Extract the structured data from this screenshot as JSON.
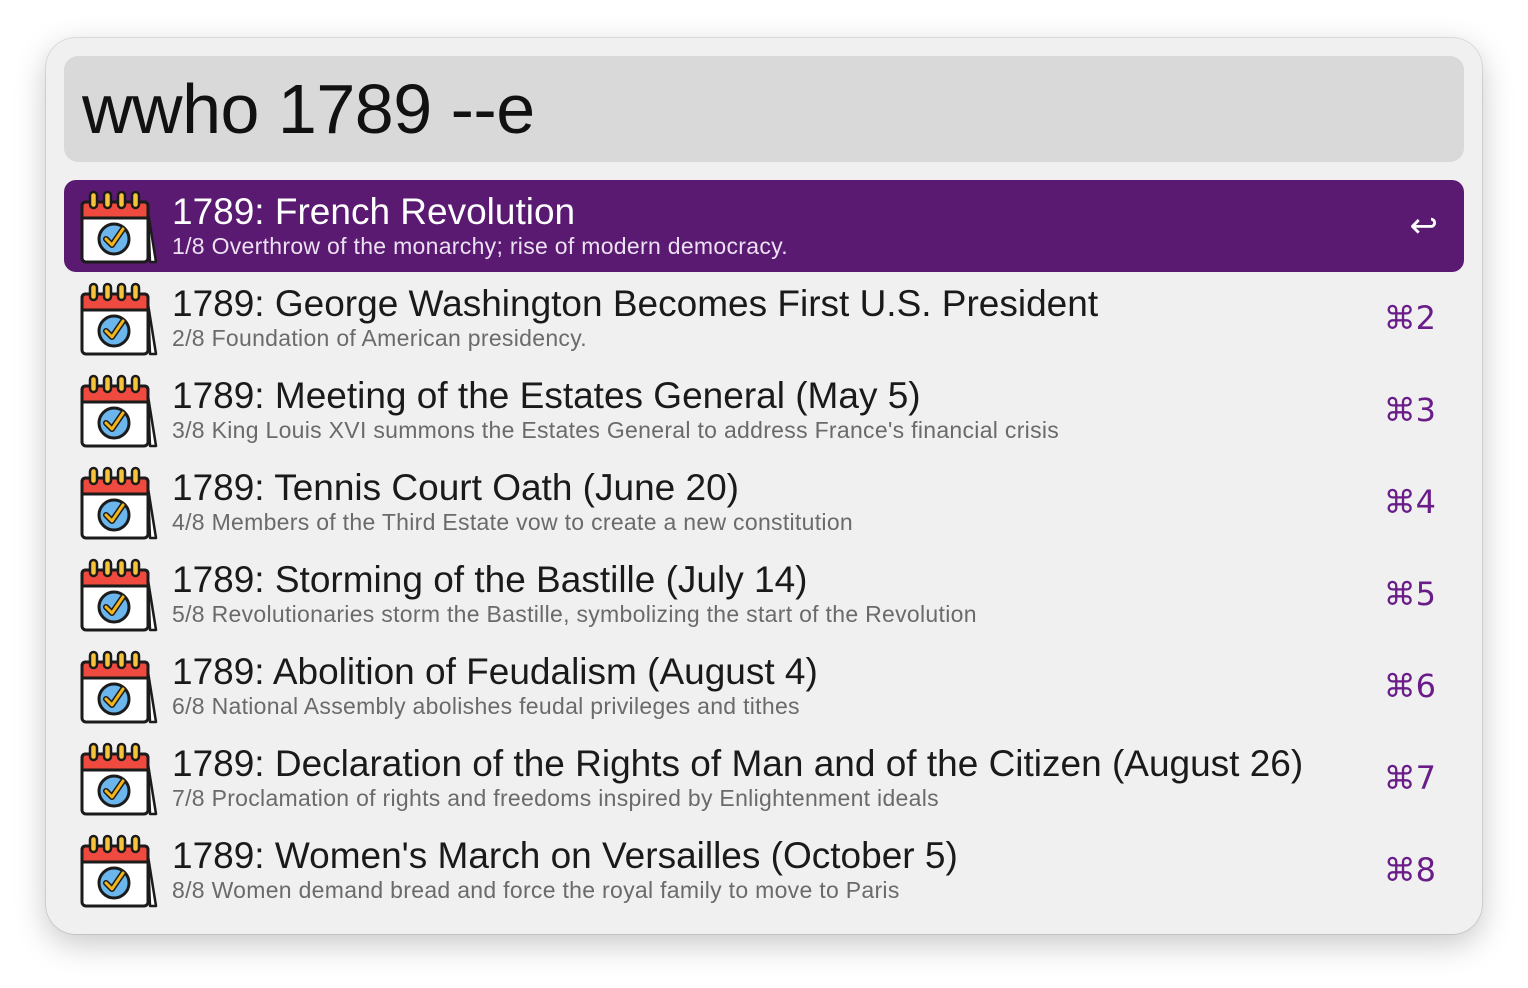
{
  "search": {
    "query": "wwho 1789 --e"
  },
  "results": [
    {
      "title": "1789: French Revolution",
      "subtitle": "1/8 Overthrow of the monarchy; rise of modern democracy.",
      "shortcut": "↩",
      "selected": true,
      "icon": "calendar-check-icon"
    },
    {
      "title": "1789: George Washington Becomes First U.S. President",
      "subtitle": "2/8 Foundation of American presidency.",
      "shortcut": "⌘2",
      "selected": false,
      "icon": "calendar-check-icon"
    },
    {
      "title": "1789: Meeting of the Estates General (May 5)",
      "subtitle": "3/8 King Louis XVI summons the Estates General to address France's financial crisis",
      "shortcut": "⌘3",
      "selected": false,
      "icon": "calendar-check-icon"
    },
    {
      "title": "1789: Tennis Court Oath (June 20)",
      "subtitle": "4/8 Members of the Third Estate vow to create a new constitution",
      "shortcut": "⌘4",
      "selected": false,
      "icon": "calendar-check-icon"
    },
    {
      "title": "1789: Storming of the Bastille (July 14)",
      "subtitle": "5/8 Revolutionaries storm the Bastille, symbolizing the start of the Revolution",
      "shortcut": "⌘5",
      "selected": false,
      "icon": "calendar-check-icon"
    },
    {
      "title": "1789: Abolition of Feudalism (August 4)",
      "subtitle": "6/8 National Assembly abolishes feudal privileges and tithes",
      "shortcut": "⌘6",
      "selected": false,
      "icon": "calendar-check-icon"
    },
    {
      "title": "1789: Declaration of the Rights of Man and of the Citizen (August 26)",
      "subtitle": "7/8 Proclamation of rights and freedoms inspired by Enlightenment ideals",
      "shortcut": "⌘7",
      "selected": false,
      "icon": "calendar-check-icon"
    },
    {
      "title": "1789: Women's March on Versailles (October 5)",
      "subtitle": "8/8 Women demand bread and force the royal family to move to Paris",
      "shortcut": "⌘8",
      "selected": false,
      "icon": "calendar-check-icon"
    }
  ],
  "colors": {
    "selection": "#5b1a72",
    "shortcut": "#6a1d88",
    "calendar_header": "#ef4a3f",
    "check_circle": "#6cb6ee",
    "check_mark": "#f4b51a"
  }
}
